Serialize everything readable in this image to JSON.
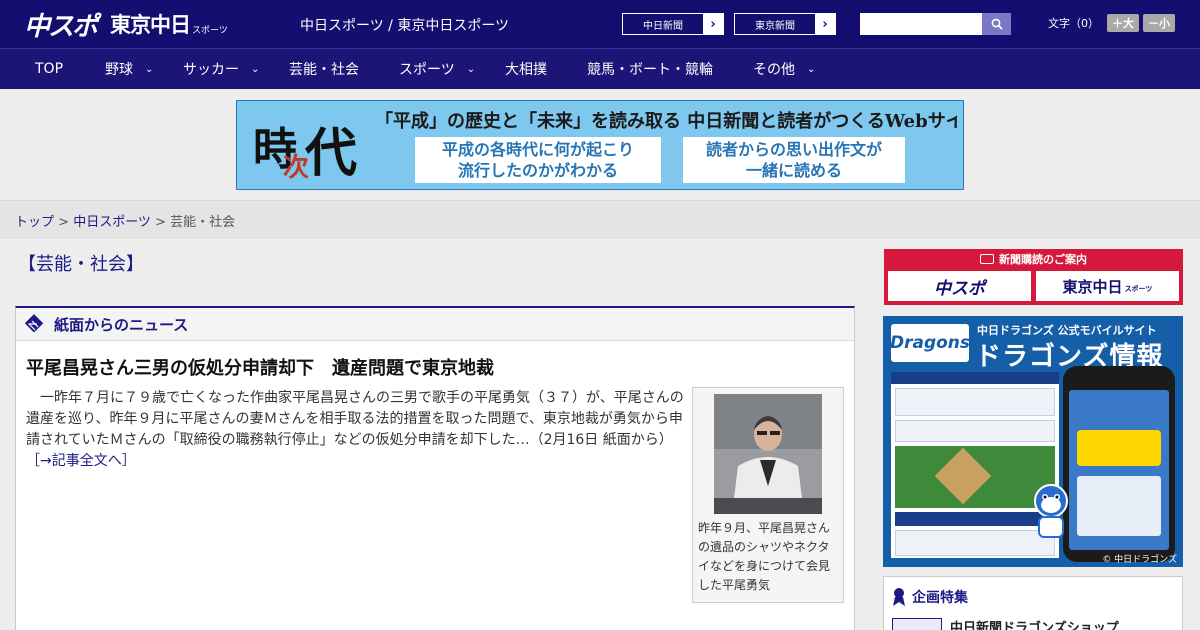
{
  "header": {
    "logo_main": "中スポ",
    "logo_sub": "東京中日",
    "logo_small": "スポーツ",
    "site_title": "中日スポーツ / 東京中日スポーツ",
    "sister1": "中日新聞",
    "sister2": "東京新聞",
    "arrow": "›",
    "search_placeholder": "",
    "font_label": "文字（0）",
    "font_bigger": "＋大",
    "font_smaller": "－小"
  },
  "nav": [
    {
      "label": "TOP"
    },
    {
      "label": "野球"
    },
    {
      "label": "サッカー"
    },
    {
      "label": "芸能・社会"
    },
    {
      "label": "スポーツ"
    },
    {
      "label": "大相撲"
    },
    {
      "label": "競馬・ボート・競輪"
    },
    {
      "label": "その他"
    }
  ],
  "banner": {
    "k1": "時",
    "k2": "次",
    "k3": "代",
    "headline": "「平成」の歴史と「未来」を読み取る 中日新聞と読者がつくるWebサイト",
    "box1_line1": "平成の各時代に何が起こり",
    "box1_line2": "流行したのかがわかる",
    "box2_line1": "読者からの思い出作文が",
    "box2_line2": "一緒に読める"
  },
  "breadcrumb": {
    "top": "トップ",
    "sep": " > ",
    "chunichi": "中日スポーツ",
    "current": "芸能・社会"
  },
  "section_title": "【芸能・社会】",
  "news": {
    "panel_title": "紙面からのニュース",
    "headline": "平尾昌晃さん三男の仮処分申請却下　遺産問題で東京地裁",
    "body": "一昨年７月に７９歳で亡くなった作曲家平尾昌晃さんの三男で歌手の平尾勇気（３７）が、平尾さんの遺産を巡り、昨年９月に平尾さんの妻Ｍさんを相手取る法的措置を取った問題で、東京地裁が勇気から申請されていたＭさんの「取締役の職務執行停止」などの仮処分申請を却下した…（2月16日 紙面から）",
    "more": "［→記事全文へ］",
    "caption": "昨年９月、平尾昌晃さんの遺品のシャツやネクタイなどを身につけて会見した平尾勇気"
  },
  "sidebar": {
    "subscribe_header": "新聞購読のご案内",
    "sub1": "中スポ",
    "sub2": "東京中日",
    "sub2_small": "スポーツ",
    "dragons_brand": "Dragons",
    "dragons_top": "中日ドラゴンズ 公式モバイルサイト",
    "dragons_title": "ドラゴンズ情報",
    "dragons_footer": "© 中日ドラゴンズ",
    "feature_title": "企画特集",
    "feature_item": "中日新聞ドラゴンズショップ"
  }
}
